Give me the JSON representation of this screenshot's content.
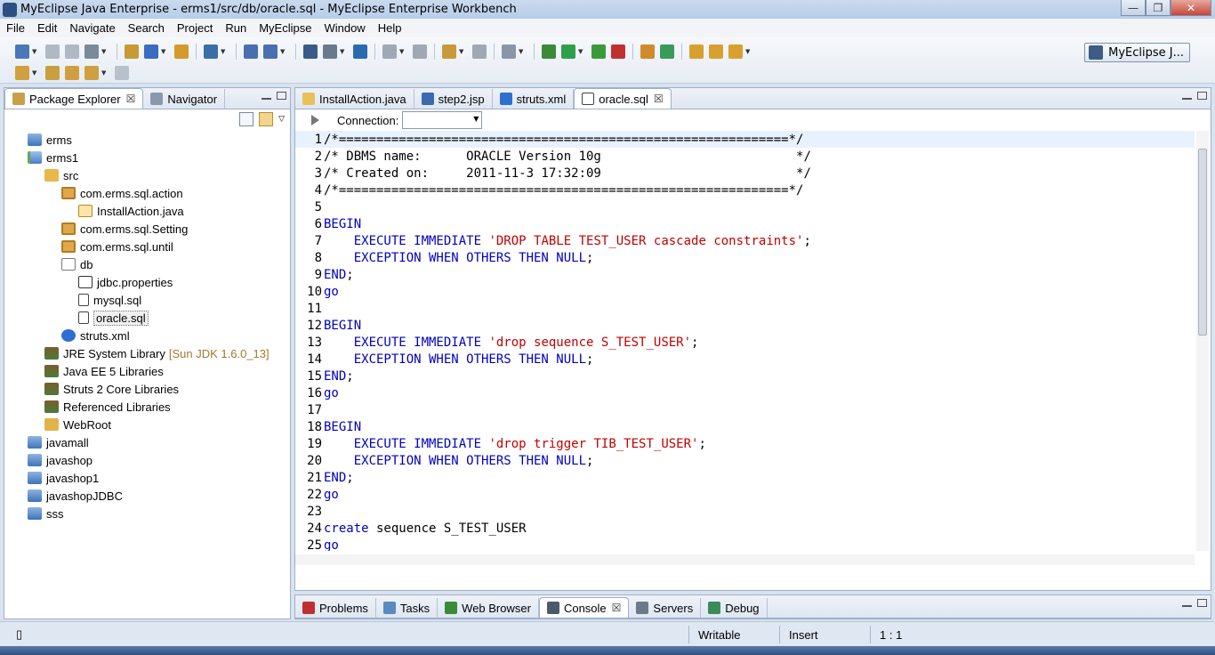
{
  "window": {
    "title": "MyEclipse Java Enterprise - erms1/src/db/oracle.sql - MyEclipse Enterprise Workbench",
    "min_label": "—",
    "max_label": "❐",
    "close_label": "✕"
  },
  "menu": [
    "File",
    "Edit",
    "Navigate",
    "Search",
    "Project",
    "Run",
    "MyEclipse",
    "Window",
    "Help"
  ],
  "perspective": {
    "label": "MyEclipse J..."
  },
  "explorer": {
    "tabs": [
      {
        "label": "Package Explorer",
        "close": "☒"
      },
      {
        "label": "Navigator"
      }
    ],
    "tree": [
      {
        "label": "erms",
        "icon": "folder-icon",
        "depth": 0
      },
      {
        "label": "erms1",
        "icon": "project-icon",
        "depth": 0
      },
      {
        "label": "src",
        "icon": "source-folder-icon",
        "depth": 1
      },
      {
        "label": "com.erms.sql.action",
        "icon": "package-icon",
        "depth": 2
      },
      {
        "label": "InstallAction.java",
        "icon": "java-file-icon",
        "depth": 3
      },
      {
        "label": "com.erms.sql.Setting",
        "icon": "package-icon",
        "depth": 2
      },
      {
        "label": "com.erms.sql.until",
        "icon": "package-icon",
        "depth": 2
      },
      {
        "label": "db",
        "icon": "db-folder-icon",
        "depth": 2
      },
      {
        "label": "jdbc.properties",
        "icon": "properties-file-icon",
        "depth": 3
      },
      {
        "label": "mysql.sql",
        "icon": "sql-file-icon",
        "depth": 3
      },
      {
        "label": "oracle.sql",
        "icon": "sql-file-icon",
        "depth": 3,
        "selected": true
      },
      {
        "label": "struts.xml",
        "icon": "xml-file-icon",
        "depth": 2
      },
      {
        "label": "JRE System Library",
        "icon": "library-icon",
        "depth": 1,
        "decoration": "[Sun JDK 1.6.0_13]"
      },
      {
        "label": "Java EE 5 Libraries",
        "icon": "library-icon",
        "depth": 1
      },
      {
        "label": "Struts 2 Core Libraries",
        "icon": "library-icon",
        "depth": 1
      },
      {
        "label": "Referenced Libraries",
        "icon": "library-icon",
        "depth": 1
      },
      {
        "label": "WebRoot",
        "icon": "webroot-folder-icon",
        "depth": 1
      },
      {
        "label": "javamall",
        "icon": "folder-icon",
        "depth": 0
      },
      {
        "label": "javashop",
        "icon": "folder-icon",
        "depth": 0
      },
      {
        "label": "javashop1",
        "icon": "folder-icon",
        "depth": 0
      },
      {
        "label": "javashopJDBC",
        "icon": "folder-icon",
        "depth": 0
      },
      {
        "label": "sss",
        "icon": "folder-icon",
        "depth": 0
      }
    ]
  },
  "editor": {
    "tabs": [
      {
        "label": "InstallAction.java",
        "icon": "java-file-icon"
      },
      {
        "label": "step2.jsp",
        "icon": "jsp-file-icon"
      },
      {
        "label": "struts.xml",
        "icon": "xml-file-icon"
      },
      {
        "label": "oracle.sql",
        "icon": "sql-file-icon",
        "active": true,
        "close": "☒"
      }
    ],
    "connection_label": "Connection:",
    "connection_value": "",
    "lines": [
      [
        [
          "",
          "/*============================================================*/"
        ]
      ],
      [
        [
          "",
          "/* DBMS name:      ORACLE Version 10g                          */"
        ]
      ],
      [
        [
          "",
          "/* Created on:     2011-11-3 17:32:09                          */"
        ]
      ],
      [
        [
          "",
          "/*============================================================*/"
        ]
      ],
      [],
      [
        [
          "kw",
          "BEGIN"
        ]
      ],
      [
        [
          "",
          "    "
        ],
        [
          "kw",
          "EXECUTE IMMEDIATE"
        ],
        [
          "",
          " "
        ],
        [
          "str",
          "'DROP TABLE TEST_USER cascade constraints'"
        ],
        [
          "",
          ";"
        ]
      ],
      [
        [
          "",
          "    "
        ],
        [
          "kw",
          "EXCEPTION WHEN OTHERS THEN NULL"
        ],
        [
          "",
          ";"
        ]
      ],
      [
        [
          "kw",
          "END"
        ],
        [
          "",
          ";"
        ]
      ],
      [
        [
          "kw",
          "go"
        ]
      ],
      [],
      [
        [
          "kw",
          "BEGIN"
        ]
      ],
      [
        [
          "",
          "    "
        ],
        [
          "kw",
          "EXECUTE IMMEDIATE"
        ],
        [
          "",
          " "
        ],
        [
          "str",
          "'drop sequence S_TEST_USER'"
        ],
        [
          "",
          ";"
        ]
      ],
      [
        [
          "",
          "    "
        ],
        [
          "kw",
          "EXCEPTION WHEN OTHERS THEN NULL"
        ],
        [
          "",
          ";"
        ]
      ],
      [
        [
          "kw",
          "END"
        ],
        [
          "",
          ";"
        ]
      ],
      [
        [
          "kw",
          "go"
        ]
      ],
      [],
      [
        [
          "kw",
          "BEGIN"
        ]
      ],
      [
        [
          "",
          "    "
        ],
        [
          "kw",
          "EXECUTE IMMEDIATE"
        ],
        [
          "",
          " "
        ],
        [
          "str",
          "'drop trigger TIB_TEST_USER'"
        ],
        [
          "",
          ";"
        ]
      ],
      [
        [
          "",
          "    "
        ],
        [
          "kw",
          "EXCEPTION WHEN OTHERS THEN NULL"
        ],
        [
          "",
          ";"
        ]
      ],
      [
        [
          "kw",
          "END"
        ],
        [
          "",
          ";"
        ]
      ],
      [
        [
          "kw",
          "go"
        ]
      ],
      [],
      [
        [
          "kw",
          "create"
        ],
        [
          "",
          " sequence S_TEST_USER"
        ]
      ],
      [
        [
          "kw",
          "go"
        ]
      ]
    ]
  },
  "bottom": {
    "tabs": [
      {
        "label": "Problems",
        "icon": "problems-icon"
      },
      {
        "label": "Tasks",
        "icon": "tasks-icon"
      },
      {
        "label": "Web Browser",
        "icon": "web-browser-icon"
      },
      {
        "label": "Console",
        "icon": "console-icon",
        "active": true,
        "close": "☒"
      },
      {
        "label": "Servers",
        "icon": "servers-icon"
      },
      {
        "label": "Debug",
        "icon": "debug-icon"
      }
    ]
  },
  "status": {
    "writable": "Writable",
    "insert": "Insert",
    "position": "1 : 1"
  },
  "colors": {
    "keyword": "#0000c0",
    "string": "#c00000"
  }
}
